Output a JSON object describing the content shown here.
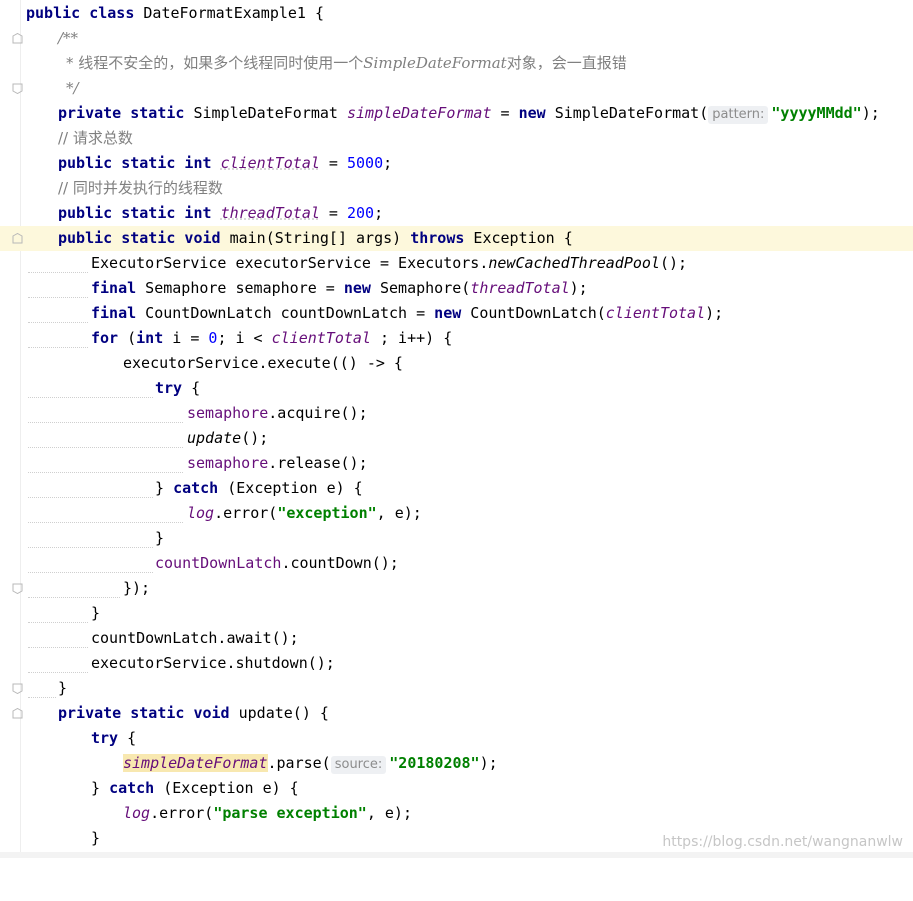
{
  "code": {
    "l1": {
      "k1": "public class",
      "t1": " DateFormatExample1 {"
    },
    "l2": {
      "c1": "/**"
    },
    "l3": {
      "c1": "* 线程不安全的，如果多个线程同时使用一个",
      "c2": "SimpleDateFormat",
      "c3": "对象，会一直报错"
    },
    "l4": {
      "c1": "*/"
    },
    "l5": {
      "k1": "private static",
      "t1": " SimpleDateFormat ",
      "f1": "simpleDateFormat",
      "t2": " = ",
      "k2": "new",
      "t3": " SimpleDateFormat(",
      "h1": "pattern:",
      "s1": "\"yyyyMMdd\"",
      "t4": ");"
    },
    "l6": {
      "c1": "// 请求总数"
    },
    "l7": {
      "k1": "public static int",
      "f1": "clientTotal",
      "t1": " = ",
      "n1": "5000",
      "t2": ";"
    },
    "l8": {
      "c1": "// 同时并发执行的线程数"
    },
    "l9": {
      "k1": "public static int",
      "f1": "threadTotal",
      "t1": " = ",
      "n1": "200",
      "t2": ";"
    },
    "l10": {
      "k1": "public static void",
      "t1": " main(String[] args) ",
      "k2": "throws",
      "t2": " Exception {"
    },
    "l11": {
      "t1": "ExecutorService executorService = Executors.",
      "i1": "newCachedThreadPool",
      "t2": "();"
    },
    "l12": {
      "k1": "final",
      "t1": " Semaphore semaphore = ",
      "k2": "new",
      "t2": " Semaphore(",
      "f1": "threadTotal",
      "t3": ");"
    },
    "l13": {
      "k1": "final",
      "t1": " CountDownLatch countDownLatch = ",
      "k2": "new",
      "t2": " CountDownLatch(",
      "f1": "clientTotal",
      "t3": ");"
    },
    "l14": {
      "k1": "for",
      "t1": " (",
      "k2": "int",
      "t2": " i = ",
      "n1": "0",
      "t3": "; i < ",
      "f1": "clientTotal",
      "t4": " ; i++) {"
    },
    "l15": {
      "t1": "executorService.execute(() -> {"
    },
    "l16": {
      "k1": "try",
      "t1": " {"
    },
    "l17": {
      "f1": "semaphore",
      "t1": ".acquire();"
    },
    "l18": {
      "i1": "update",
      "t1": "();"
    },
    "l19": {
      "f1": "semaphore",
      "t1": ".release();"
    },
    "l20": {
      "t1": "} ",
      "k1": "catch",
      "t2": " (Exception e) {"
    },
    "l21": {
      "f1": "log",
      "t1": ".error(",
      "s1": "\"exception\"",
      "t2": ", e);"
    },
    "l22": {
      "t1": "}"
    },
    "l23": {
      "f1": "countDownLatch",
      "t1": ".countDown();"
    },
    "l24": {
      "t1": "});"
    },
    "l25": {
      "t1": "}"
    },
    "l26": {
      "t1": "countDownLatch.await();"
    },
    "l27": {
      "t1": "executorService.shutdown();"
    },
    "l28": {
      "t1": "}"
    },
    "l29": {
      "k1": "private static void",
      "t1": " update() {"
    },
    "l30": {
      "k1": "try",
      "t1": " {"
    },
    "l31": {
      "f1": "simpleDateFormat",
      "t1": ".parse(",
      "h1": "source:",
      "s1": "\"20180208\"",
      "t2": ");"
    },
    "l32": {
      "t1": "} ",
      "k1": "catch",
      "t2": " (Exception e) {"
    },
    "l33": {
      "f1": "log",
      "t1": ".error(",
      "s1": "\"parse exception\"",
      "t2": ", e);"
    },
    "l34": {
      "t1": "}"
    }
  },
  "watermark": "https://blog.csdn.net/wangnanwlw",
  "colors": {
    "keyword": "#000080",
    "comment": "#808080",
    "field": "#660e7a",
    "string": "#008000",
    "number": "#0000ff",
    "current_line": "#fdf8dc"
  },
  "icons": [
    "fold-open-icon",
    "fold-close-icon"
  ]
}
